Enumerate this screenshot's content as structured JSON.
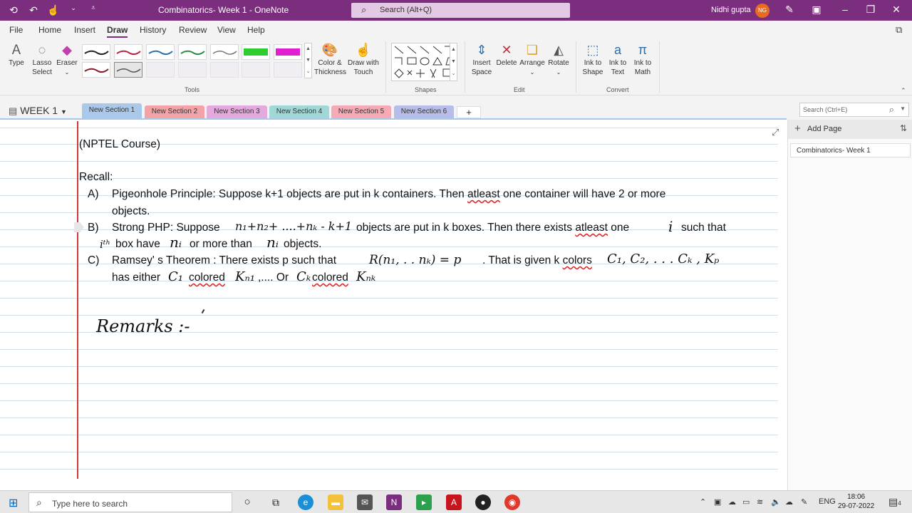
{
  "titlebar": {
    "title": "Combinatorics- Week 1  -  OneNote",
    "search_placeholder": "Search (Alt+Q)",
    "user_name": "Nidhi gupta",
    "user_initials": "NG"
  },
  "menu": [
    "File",
    "Home",
    "Insert",
    "Draw",
    "History",
    "Review",
    "View",
    "Help"
  ],
  "ribbon": {
    "type": "Type",
    "lasso": [
      "Lasso",
      "Select"
    ],
    "eraser": "Eraser",
    "color_thickness": [
      "Color &",
      "Thickness"
    ],
    "draw_touch": [
      "Draw with",
      "Touch"
    ],
    "tools_label": "Tools",
    "shapes_label": "Shapes",
    "insert_space": [
      "Insert",
      "Space"
    ],
    "delete": "Delete",
    "arrange": "Arrange",
    "rotate": "Rotate",
    "edit_label": "Edit",
    "ink_shape": [
      "Ink to",
      "Shape"
    ],
    "ink_text": [
      "Ink to",
      "Text"
    ],
    "ink_math": [
      "Ink to",
      "Math"
    ],
    "convert_label": "Convert",
    "pen_colors": [
      "#222222",
      "#b8243c",
      "#2e6fa8",
      "#2f8a4a",
      "#777777",
      "#2ecc2e",
      "#e020d0",
      "#8b1a2a",
      "#555555"
    ]
  },
  "notebook": "WEEK 1",
  "sections": [
    {
      "label": "New Section 1",
      "color": "#a9c8ea"
    },
    {
      "label": "New Section 2",
      "color": "#f3a3a8"
    },
    {
      "label": "New Section 3",
      "color": "#e4a9dd"
    },
    {
      "label": "New Section 4",
      "color": "#9fd8d6"
    },
    {
      "label": "New Section 5",
      "color": "#f5aab5"
    },
    {
      "label": "New Section 6",
      "color": "#b6bde8"
    }
  ],
  "search_notes": "Search (Ctrl+E)",
  "pages_pane": {
    "add_page": "Add Page",
    "pages": [
      "Combinatorics- Week 1"
    ]
  },
  "note": {
    "course": "(NPTEL Course)",
    "recall": "Recall:",
    "a_label": "A)",
    "a_text": "Pigeonhole Principle:  Suppose k+1 objects are put in k containers. Then ",
    "a_sq": "atleast",
    "a_text2": " one container will have  2 or more",
    "a_text3": "objects.",
    "b_label": "B)",
    "b_text": "Strong PHP: Suppose",
    "b_ink1": "n₁+n₂+ ....+nₖ - k+1",
    "b_text2": "objects are put in k boxes. Then there exists ",
    "b_sq": "atleast",
    "b_text3": " one",
    "b_ink2": "i",
    "b_text4": "such that",
    "b_ink3": "iᵗʰ",
    "b_text5": "box have",
    "b_ink4": "nᵢ",
    "b_text6": "or more than",
    "b_ink5": "nᵢ",
    "b_text7": "objects.",
    "c_label": "C)",
    "c_text": "Ramsey' s Theorem : There exists p such that",
    "c_ink1": "R(n₁, . . nₖ) = p",
    "c_text2": ". That is given k ",
    "c_sq": "colors",
    "c_ink2": "C₁, C₂, . . .   Cₖ , Kₚ",
    "c_text3": "has either",
    "c_ink3": "C₁",
    "c_sq2": "colored",
    "c_ink4": "Kₙ₁",
    "c_text4": ",.... Or",
    "c_ink5": "Cₖ",
    "c_sq3": "colored",
    "c_ink6": "Kₙₖ",
    "remarks_ink": "Remarks :-"
  },
  "taskbar": {
    "search_placeholder": "Type here to search",
    "lang": "ENG",
    "time": "18:06",
    "date": "29-07-2022",
    "notifications": "4"
  }
}
